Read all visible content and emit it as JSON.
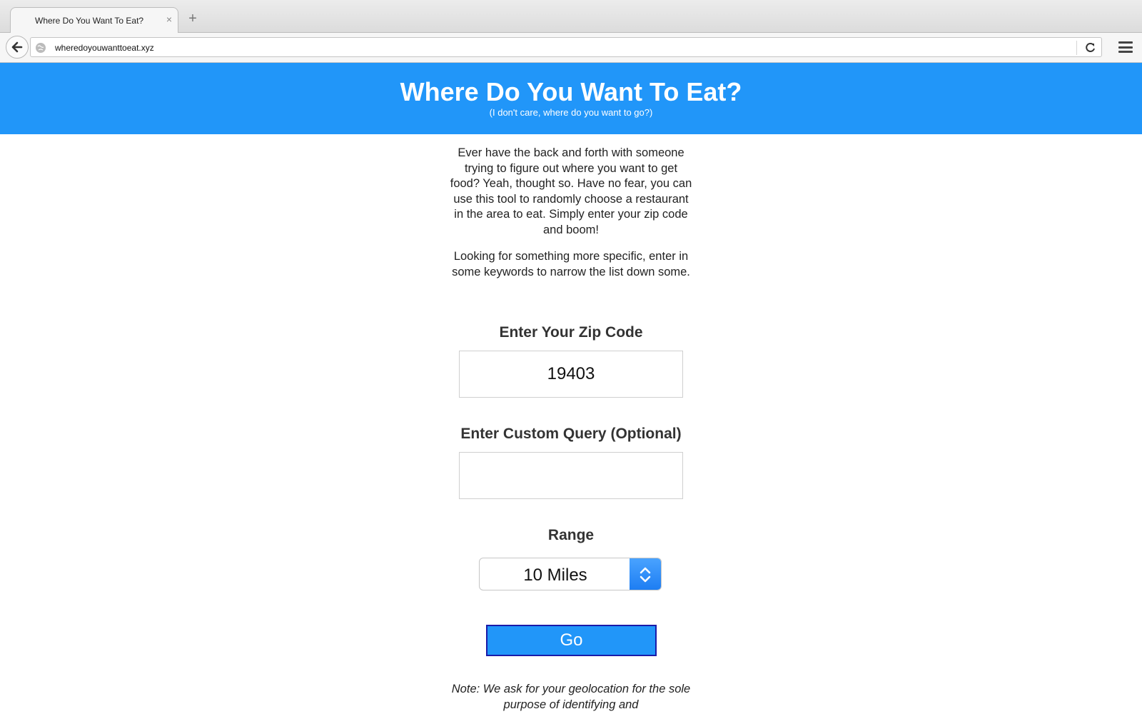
{
  "browser": {
    "tab_title": "Where Do You Want To Eat?",
    "tab_close": "×",
    "new_tab": "+",
    "url": "wheredoyouwanttoeat.xyz"
  },
  "header": {
    "title": "Where Do You Want To Eat?",
    "subtitle": "(I don't care, where do you want to go?)",
    "background": "#2196f9"
  },
  "intro": {
    "paragraph1": "Ever have the back and forth with someone trying to figure out where you want to get food? Yeah, thought so. Have no fear, you can use this tool to randomly choose a restaurant in the area to eat. Simply enter your zip code and boom!",
    "paragraph2": "Looking for something more specific, enter in some keywords to narrow the list down some."
  },
  "form": {
    "zip_label": "Enter Your Zip Code",
    "zip_value": "19403",
    "query_label": "Enter Custom Query (Optional)",
    "query_value": "",
    "range_label": "Range",
    "range_value": "10 Miles",
    "go_label": "Go"
  },
  "note": "Note: We ask for your geolocation for the sole purpose of identifying and"
}
